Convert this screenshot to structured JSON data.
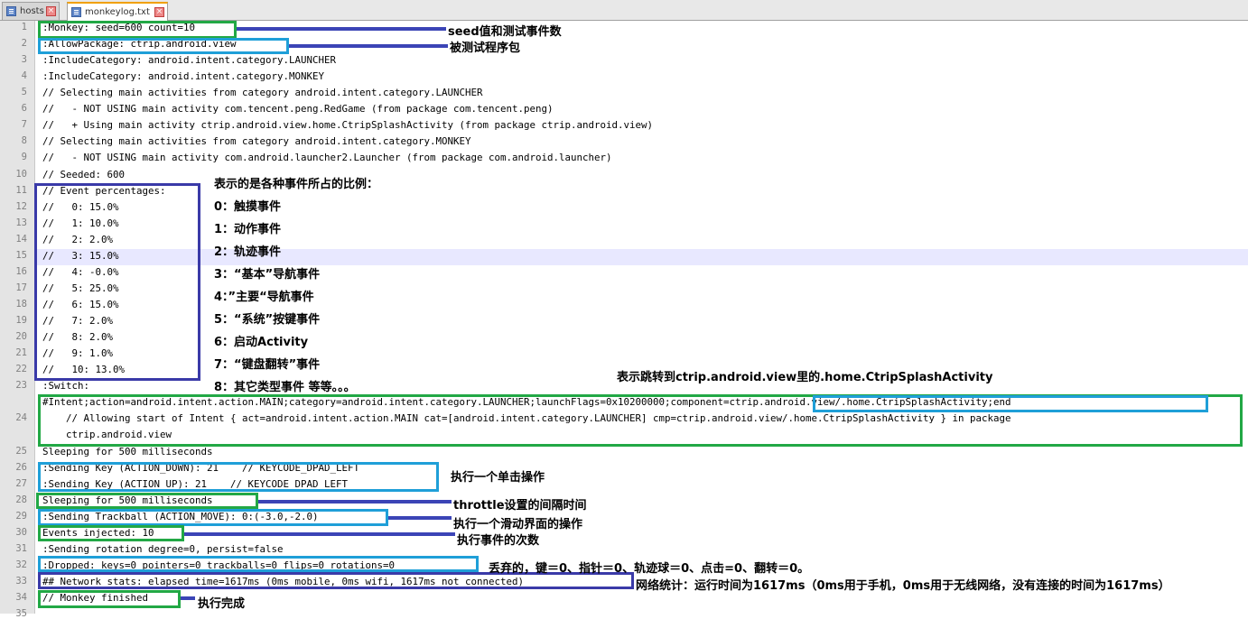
{
  "tabs": [
    {
      "label": "hosts",
      "active": false
    },
    {
      "label": "monkeylog.txt",
      "active": true
    }
  ],
  "lines": [
    {
      "n": "1",
      "text": ":Monkey: seed=600 count=10"
    },
    {
      "n": "2",
      "text": ":AllowPackage: ctrip.android.view"
    },
    {
      "n": "3",
      "text": ":IncludeCategory: android.intent.category.LAUNCHER"
    },
    {
      "n": "4",
      "text": ":IncludeCategory: android.intent.category.MONKEY"
    },
    {
      "n": "5",
      "text": "// Selecting main activities from category android.intent.category.LAUNCHER"
    },
    {
      "n": "6",
      "text": "//   - NOT USING main activity com.tencent.peng.RedGame (from package com.tencent.peng)"
    },
    {
      "n": "7",
      "text": "//   + Using main activity ctrip.android.view.home.CtripSplashActivity (from package ctrip.android.view)"
    },
    {
      "n": "8",
      "text": "// Selecting main activities from category android.intent.category.MONKEY"
    },
    {
      "n": "9",
      "text": "//   - NOT USING main activity com.android.launcher2.Launcher (from package com.android.launcher)"
    },
    {
      "n": "10",
      "text": "// Seeded: 600"
    },
    {
      "n": "11",
      "text": "// Event percentages:"
    },
    {
      "n": "12",
      "text": "//   0: 15.0%"
    },
    {
      "n": "13",
      "text": "//   1: 10.0%"
    },
    {
      "n": "14",
      "text": "//   2: 2.0%"
    },
    {
      "n": "15",
      "text": "//   3: 15.0%"
    },
    {
      "n": "16",
      "text": "//   4: -0.0%"
    },
    {
      "n": "17",
      "text": "//   5: 25.0%"
    },
    {
      "n": "18",
      "text": "//   6: 15.0%"
    },
    {
      "n": "19",
      "text": "//   7: 2.0%"
    },
    {
      "n": "20",
      "text": "//   8: 2.0%"
    },
    {
      "n": "21",
      "text": "//   9: 1.0%"
    },
    {
      "n": "22",
      "text": "//   10: 13.0%"
    },
    {
      "n": "23",
      "text": ":Switch:"
    },
    {
      "n": "24",
      "text": "#Intent;action=android.intent.action.MAIN;category=android.intent.category.LAUNCHER;launchFlags=0x10200000;component=ctrip.android.view/.home.CtripSplashActivity;end"
    },
    {
      "n": "",
      "text": "    // Allowing start of Intent { act=android.intent.action.MAIN cat=[android.intent.category.LAUNCHER] cmp=ctrip.android.view/.home.CtripSplashActivity } in package"
    },
    {
      "n": "",
      "text": "    ctrip.android.view"
    },
    {
      "n": "25",
      "text": "Sleeping for 500 milliseconds"
    },
    {
      "n": "26",
      "text": ":Sending Key (ACTION_DOWN): 21    // KEYCODE_DPAD_LEFT"
    },
    {
      "n": "27",
      "text": ":Sending Key (ACTION_UP): 21    // KEYCODE_DPAD_LEFT"
    },
    {
      "n": "28",
      "text": "Sleeping for 500 milliseconds"
    },
    {
      "n": "29",
      "text": ":Sending Trackball (ACTION_MOVE): 0:(-3.0,-2.0)"
    },
    {
      "n": "30",
      "text": "Events injected: 10"
    },
    {
      "n": "31",
      "text": ":Sending rotation degree=0, persist=false"
    },
    {
      "n": "32",
      "text": ":Dropped: keys=0 pointers=0 trackballs=0 flips=0 rotations=0"
    },
    {
      "n": "33",
      "text": "## Network stats: elapsed time=1617ms (0ms mobile, 0ms wifi, 1617ms not connected)"
    },
    {
      "n": "34",
      "text": "// Monkey finished"
    },
    {
      "n": "35",
      "text": ""
    }
  ],
  "annotations": {
    "seed": "seed值和测试事件数",
    "package": "被测试程序包",
    "percent_title": "表示的是各种事件所占的比例：",
    "percent_items": [
      "0：触摸事件",
      "1：动作事件",
      "2：轨迹事件",
      "3：“基本”导航事件",
      "4：”主要“导航事件",
      "5：“系统”按键事件",
      "6：启动Activity",
      "7：“键盘翻转”事件",
      "8：其它类型事件 等等。。。"
    ],
    "jump": "表示跳转到ctrip.android.view里的.home.CtripSplashActivity",
    "click": "执行一个单击操作",
    "throttle": "throttle设置的间隔时间",
    "swipe": "执行一个滑动界面的操作",
    "count": "执行事件的次数",
    "dropped": "丢弃的，键＝0、指针＝0、轨迹球＝0、点击=0、翻转＝0。",
    "network": "网络统计：运行时间为1617ms（0ms用于手机，0ms用于无线网络，没有连接的时间为1617ms）",
    "finished": "执行完成"
  },
  "colors": {
    "green": "#22a845",
    "cyan": "#1f9fd8",
    "navy": "#3a3aa8",
    "arrow": "#3b44b6",
    "gutter": "#e4e4e4",
    "current_line": "#e8e8ff"
  }
}
